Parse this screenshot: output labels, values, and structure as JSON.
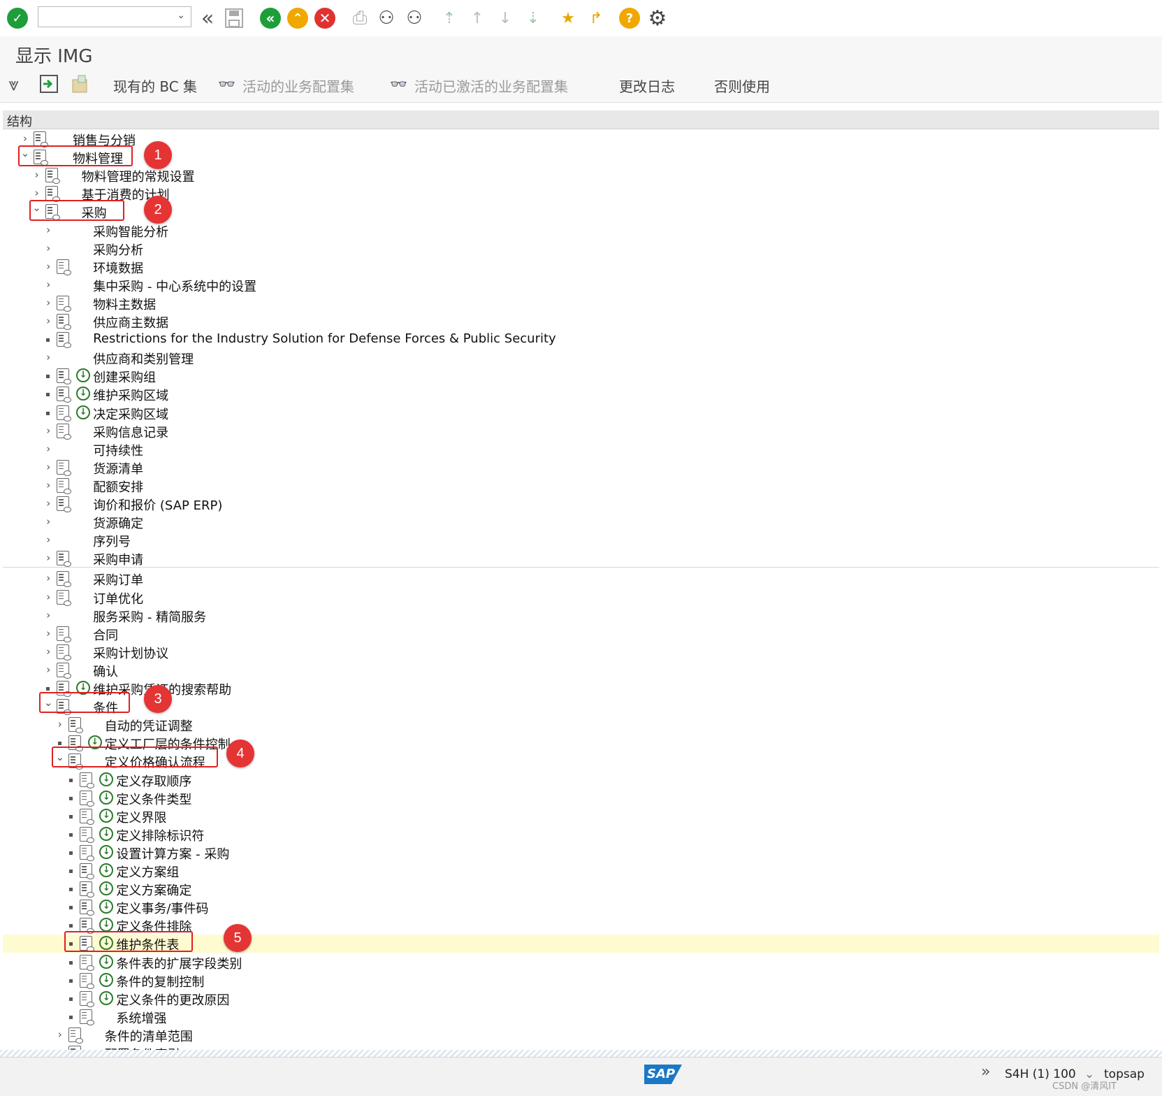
{
  "toolbar": {
    "enter_icon": "check-icon",
    "command_placeholder": "",
    "colors": {
      "green": "#1e9e3a",
      "yellow": "#f0a800",
      "red": "#e0322f"
    }
  },
  "title": "显示 IMG",
  "app_toolbar": {
    "existing_bc_sets": "现有的 BC 集",
    "active_bc_sets": "活动的业务配置集",
    "activated_bc_sets": "活动已激活的业务配置集",
    "change_log": "更改日志",
    "where_used": "否则使用"
  },
  "tree_header": "结构",
  "tree": [
    {
      "label": "销售与分销",
      "level": 0,
      "exp": "closed",
      "doc": true,
      "exec": false
    },
    {
      "label": "物料管理",
      "level": 0,
      "exp": "open",
      "doc": true,
      "exec": false
    },
    {
      "label": "物料管理的常规设置",
      "level": 1,
      "exp": "closed",
      "doc": true,
      "exec": false
    },
    {
      "label": "基于消费的计划",
      "level": 1,
      "exp": "closed",
      "doc": true,
      "exec": false
    },
    {
      "label": "采购",
      "level": 1,
      "exp": "open",
      "doc": true,
      "exec": false
    },
    {
      "label": "采购智能分析",
      "level": 2,
      "exp": "closed",
      "doc": false,
      "exec": false
    },
    {
      "label": "采购分析",
      "level": 2,
      "exp": "closed",
      "doc": false,
      "exec": false
    },
    {
      "label": "环境数据",
      "level": 2,
      "exp": "closed",
      "doc": true,
      "exec": false
    },
    {
      "label": "集中采购 - 中心系统中的设置",
      "level": 2,
      "exp": "closed",
      "doc": false,
      "exec": false
    },
    {
      "label": "物料主数据",
      "level": 2,
      "exp": "closed",
      "doc": true,
      "exec": false
    },
    {
      "label": "供应商主数据",
      "level": 2,
      "exp": "closed",
      "doc": true,
      "exec": false
    },
    {
      "label": "Restrictions for the Industry Solution for Defense Forces & Public Security",
      "level": 2,
      "exp": "bullet",
      "doc": true,
      "exec": false
    },
    {
      "label": "供应商和类别管理",
      "level": 2,
      "exp": "closed",
      "doc": false,
      "exec": false
    },
    {
      "label": "创建采购组",
      "level": 2,
      "exp": "bullet",
      "doc": true,
      "exec": true
    },
    {
      "label": "维护采购区域",
      "level": 2,
      "exp": "bullet",
      "doc": true,
      "exec": true
    },
    {
      "label": "决定采购区域",
      "level": 2,
      "exp": "bullet",
      "doc": true,
      "exec": true
    },
    {
      "label": "采购信息记录",
      "level": 2,
      "exp": "closed",
      "doc": true,
      "exec": false
    },
    {
      "label": "可持续性",
      "level": 2,
      "exp": "closed",
      "doc": false,
      "exec": false
    },
    {
      "label": "货源清单",
      "level": 2,
      "exp": "closed",
      "doc": true,
      "exec": false
    },
    {
      "label": "配额安排",
      "level": 2,
      "exp": "closed",
      "doc": true,
      "exec": false
    },
    {
      "label": "询价和报价 (SAP ERP)",
      "level": 2,
      "exp": "closed",
      "doc": true,
      "exec": false
    },
    {
      "label": "货源确定",
      "level": 2,
      "exp": "closed",
      "doc": false,
      "exec": false
    },
    {
      "label": "序列号",
      "level": 2,
      "exp": "closed",
      "doc": false,
      "exec": false
    },
    {
      "label": "采购申请",
      "level": 2,
      "exp": "closed",
      "doc": true,
      "exec": false
    },
    {
      "label": "采购订单",
      "level": 2,
      "exp": "closed",
      "doc": true,
      "exec": false
    },
    {
      "label": "订单优化",
      "level": 2,
      "exp": "closed",
      "doc": true,
      "exec": false
    },
    {
      "label": "服务采购 - 精简服务",
      "level": 2,
      "exp": "closed",
      "doc": false,
      "exec": false
    },
    {
      "label": "合同",
      "level": 2,
      "exp": "closed",
      "doc": true,
      "exec": false
    },
    {
      "label": "采购计划协议",
      "level": 2,
      "exp": "closed",
      "doc": true,
      "exec": false
    },
    {
      "label": "确认",
      "level": 2,
      "exp": "closed",
      "doc": true,
      "exec": false
    },
    {
      "label": "维护采购凭证的搜索帮助",
      "level": 2,
      "exp": "bullet",
      "doc": true,
      "exec": true
    },
    {
      "label": "条件",
      "level": 2,
      "exp": "open",
      "doc": true,
      "exec": false
    },
    {
      "label": "自动的凭证调整",
      "level": 3,
      "exp": "closed",
      "doc": true,
      "exec": false
    },
    {
      "label": "定义工厂层的条件控制",
      "level": 3,
      "exp": "bullet",
      "doc": true,
      "exec": true
    },
    {
      "label": "定义价格确认流程",
      "level": 3,
      "exp": "open",
      "doc": true,
      "exec": false
    },
    {
      "label": "定义存取顺序",
      "level": 4,
      "exp": "bullet",
      "doc": true,
      "exec": true
    },
    {
      "label": "定义条件类型",
      "level": 4,
      "exp": "bullet",
      "doc": true,
      "exec": true
    },
    {
      "label": "定义界限",
      "level": 4,
      "exp": "bullet",
      "doc": true,
      "exec": true
    },
    {
      "label": "定义排除标识符",
      "level": 4,
      "exp": "bullet",
      "doc": true,
      "exec": true
    },
    {
      "label": "设置计算方案 - 采购",
      "level": 4,
      "exp": "bullet",
      "doc": true,
      "exec": true
    },
    {
      "label": "定义方案组",
      "level": 4,
      "exp": "bullet",
      "doc": true,
      "exec": true
    },
    {
      "label": "定义方案确定",
      "level": 4,
      "exp": "bullet",
      "doc": true,
      "exec": true
    },
    {
      "label": "定义事务/事件码",
      "level": 4,
      "exp": "bullet",
      "doc": true,
      "exec": true
    },
    {
      "label": "定义条件排除",
      "level": 4,
      "exp": "bullet",
      "doc": true,
      "exec": true
    },
    {
      "label": "维护条件表",
      "level": 4,
      "exp": "bullet",
      "doc": true,
      "exec": true,
      "highlight": true
    },
    {
      "label": "条件表的扩展字段类别",
      "level": 4,
      "exp": "bullet",
      "doc": true,
      "exec": true
    },
    {
      "label": "条件的复制控制",
      "level": 4,
      "exp": "bullet",
      "doc": true,
      "exec": true
    },
    {
      "label": "定义条件的更改原因",
      "level": 4,
      "exp": "bullet",
      "doc": true,
      "exec": true
    },
    {
      "label": "系统增强",
      "level": 4,
      "exp": "bullet",
      "doc": true,
      "exec": false
    },
    {
      "label": "条件的清单范围",
      "level": 3,
      "exp": "closed",
      "doc": true,
      "exec": false
    },
    {
      "label": "配置条件索引",
      "level": 3,
      "exp": "closed",
      "doc": true,
      "exec": false
    }
  ],
  "badges": [
    "1",
    "2",
    "3",
    "4",
    "5"
  ],
  "status": {
    "logo": "SAP",
    "system": "S4H (1) 100",
    "user": "topsap",
    "watermark": "CSDN @清风IT"
  }
}
